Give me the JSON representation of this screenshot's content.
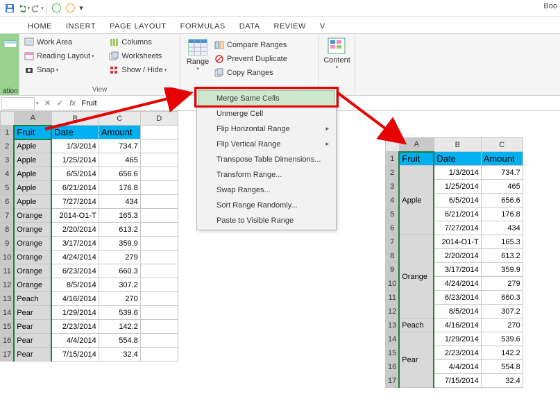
{
  "qat": {
    "title_fragment": "Boo"
  },
  "tabs": [
    "HOME",
    "INSERT",
    "PAGE LAYOUT",
    "FORMULAS",
    "DATA",
    "REVIEW",
    "V"
  ],
  "ribbon": {
    "ation_fragment": "ation",
    "view_group_label": "View",
    "view_cmds": [
      "Work Area",
      "Reading Layout",
      "Snap",
      "Columns",
      "Worksheets",
      "Show / Hide"
    ],
    "range_label": "Range",
    "range_cmds": [
      "Compare Ranges",
      "Prevent Duplicate",
      "Copy Ranges"
    ],
    "content_label": "Content"
  },
  "menu": {
    "items": [
      {
        "label": "Merge Same Cells",
        "hl": true
      },
      {
        "label": "Unmerge Cell"
      },
      {
        "label": "Flip Horizontal Range",
        "sub": true
      },
      {
        "label": "Flip Vertical Range",
        "sub": true
      },
      {
        "label": "Transpose Table Dimensions..."
      },
      {
        "label": "Transform Range..."
      },
      {
        "label": "Swap Ranges..."
      },
      {
        "label": "Sort Range Randomly..."
      },
      {
        "label": "Paste to Visible Range"
      }
    ]
  },
  "fbar": {
    "name_box_value": "",
    "formula_value": "Fruit"
  },
  "sheet": {
    "columns": [
      "A",
      "B",
      "C",
      "D"
    ],
    "headers": [
      "Fruit",
      "Date",
      "Amount"
    ],
    "rows": [
      {
        "a": "Apple",
        "b": "1/3/2014",
        "c": "734.7"
      },
      {
        "a": "Apple",
        "b": "1/25/2014",
        "c": "465"
      },
      {
        "a": "Apple",
        "b": "6/5/2014",
        "c": "656.6"
      },
      {
        "a": "Apple",
        "b": "6/21/2014",
        "c": "176.8"
      },
      {
        "a": "Apple",
        "b": "7/27/2014",
        "c": "434"
      },
      {
        "a": "Orange",
        "b": "2014-O1-T",
        "c": "165.3"
      },
      {
        "a": "Orange",
        "b": "2/20/2014",
        "c": "613.2"
      },
      {
        "a": "Orange",
        "b": "3/17/2014",
        "c": "359.9"
      },
      {
        "a": "Orange",
        "b": "4/24/2014",
        "c": "279"
      },
      {
        "a": "Orange",
        "b": "6/23/2014",
        "c": "660.3"
      },
      {
        "a": "Orange",
        "b": "8/5/2014",
        "c": "307.2"
      },
      {
        "a": "Peach",
        "b": "4/16/2014",
        "c": "270"
      },
      {
        "a": "Pear",
        "b": "1/29/2014",
        "c": "539.6"
      },
      {
        "a": "Pear",
        "b": "2/23/2014",
        "c": "142.2"
      },
      {
        "a": "Pear",
        "b": "4/4/2014",
        "c": "554.8"
      },
      {
        "a": "Pear",
        "b": "7/15/2014",
        "c": "32.4"
      }
    ]
  },
  "sheet_right": {
    "columns": [
      "A",
      "B",
      "C"
    ],
    "headers": [
      "Fruit",
      "Date",
      "Amount"
    ],
    "merged_groups": [
      {
        "label": "Apple",
        "span": 5
      },
      {
        "label": "Orange",
        "span": 6
      },
      {
        "label": "Peach",
        "span": 1
      },
      {
        "label": "Pear",
        "span": 4
      }
    ],
    "bc_rows": [
      {
        "b": "1/3/2014",
        "c": "734.7"
      },
      {
        "b": "1/25/2014",
        "c": "465"
      },
      {
        "b": "6/5/2014",
        "c": "656.6"
      },
      {
        "b": "6/21/2014",
        "c": "176.8"
      },
      {
        "b": "7/27/2014",
        "c": "434"
      },
      {
        "b": "2014-O1-T",
        "c": "165.3"
      },
      {
        "b": "2/20/2014",
        "c": "613.2"
      },
      {
        "b": "3/17/2014",
        "c": "359.9"
      },
      {
        "b": "4/24/2014",
        "c": "279"
      },
      {
        "b": "6/23/2014",
        "c": "660.3"
      },
      {
        "b": "8/5/2014",
        "c": "307.2"
      },
      {
        "b": "4/16/2014",
        "c": "270"
      },
      {
        "b": "1/29/2014",
        "c": "539.6"
      },
      {
        "b": "2/23/2014",
        "c": "142.2"
      },
      {
        "b": "4/4/2014",
        "c": "554.8"
      },
      {
        "b": "7/15/2014",
        "c": "32.4"
      }
    ]
  }
}
